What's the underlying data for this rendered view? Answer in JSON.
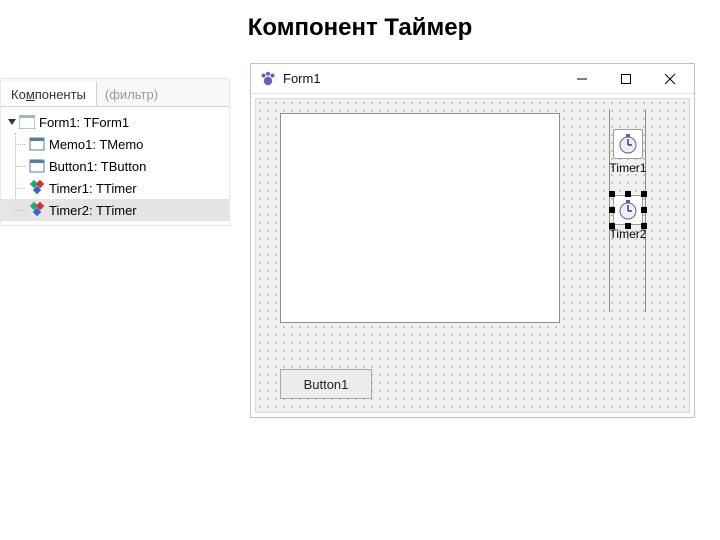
{
  "slide": {
    "title": "Компонент Таймер"
  },
  "tree": {
    "tab_label_pre": "Ко",
    "tab_label_u": "м",
    "tab_label_post": "поненты",
    "filter_placeholder": "(фильтр)",
    "root": "Form1: TForm1",
    "children": [
      {
        "label": "Memo1: TMemo",
        "icon": "control"
      },
      {
        "label": "Button1: TButton",
        "icon": "control"
      },
      {
        "label": "Timer1: TTimer",
        "icon": "component"
      },
      {
        "label": "Timer2: TTimer",
        "icon": "component",
        "selected": true
      }
    ]
  },
  "form": {
    "title": "Form1",
    "button_label": "Button1",
    "timers": [
      {
        "label": "Timer1",
        "selected": false
      },
      {
        "label": "Timer2",
        "selected": true
      }
    ]
  },
  "icons": {
    "form": "form-icon",
    "control": "control-icon",
    "component": "component-icon",
    "app": "lazarus-paw-icon",
    "minimize": "minimize-icon",
    "maximize": "maximize-icon",
    "close": "close-icon",
    "clock": "clock-icon"
  }
}
